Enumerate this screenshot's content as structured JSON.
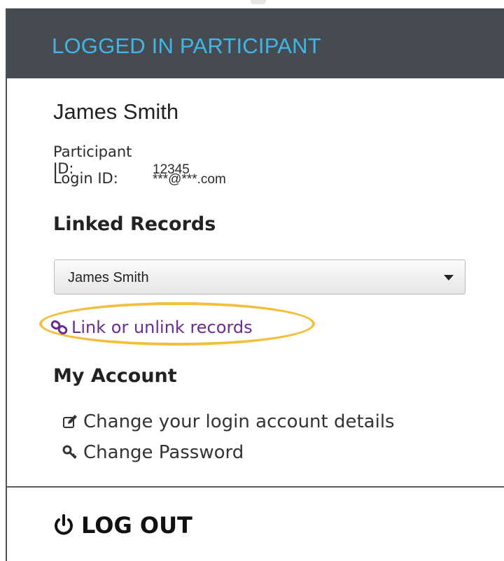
{
  "header": {
    "title": "LOGGED IN PARTICIPANT",
    "background_color": "#464b52",
    "title_color": "#41b6e6"
  },
  "participant": {
    "name": "James Smith",
    "participant_id_label": "Participant ID:",
    "participant_id_value": "12345",
    "login_id_label": "Login ID:",
    "login_id_value": "***@***.com"
  },
  "linked_records": {
    "title": "Linked Records",
    "selected": "James Smith",
    "link_label": "Link or unlink records",
    "link_color": "#6a2c91",
    "highlight_color": "#f3bf3b",
    "icon": "chain-link-icon"
  },
  "my_account": {
    "title": "My Account",
    "items": [
      {
        "label": "Change your login account details",
        "icon": "edit-icon"
      },
      {
        "label": "Change Password",
        "icon": "key-icon"
      }
    ]
  },
  "logout": {
    "label": "LOG OUT",
    "icon": "power-icon"
  }
}
